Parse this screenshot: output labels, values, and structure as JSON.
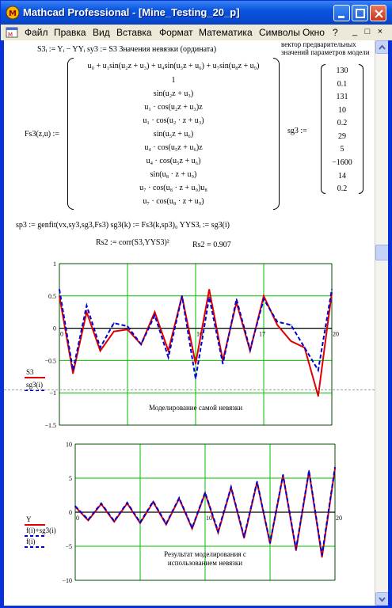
{
  "window": {
    "title": "Mathcad Professional - [Mine_Testing_20_p]",
    "colors": {
      "titlebar": "#0a55e0",
      "accent_red": "#e00000",
      "accent_blue": "#0000d0",
      "grid_green": "#00c000"
    }
  },
  "menu": [
    "Файл",
    "Правка",
    "Вид",
    "Вставка",
    "Формат",
    "Математика",
    "Символы",
    "Окно",
    "?"
  ],
  "mdi_buttons": [
    "_",
    "□",
    "×"
  ],
  "worksheet": {
    "line1": "S3ᵢ := Yᵢ − YYᵢ   sy3 := S3   Значения невязки (ордината)",
    "note_vector": [
      "вектор предварительных",
      "значений параметров модели"
    ],
    "fs3_lhs": "Fs3(z,u) :=",
    "fs3_rows": [
      "u₀ + u₁sin(u₂z + u₃) + u₄sin(u₅z + u₆) + u₇sin(u₈z + u₉)",
      "1",
      "sin(u₂z + u₃)",
      "u₁ · cos(u₂z + u₃)z",
      "u₁ · cos(u₂ · z + u₃)",
      "sin(u₅z + u₆)",
      "u₄ · cos(u₅z + u₆)z",
      "u₄ · cos(u₅z + u₆)",
      "sin(u₈ · z + u₉)",
      "u₇ · cos(u₈ · z + u₉)u₈",
      "u₇ · cos(u₈ · z + u₉)"
    ],
    "sg3_lhs": "sg3 :=",
    "sg3_values": [
      "130",
      "0.1",
      "131",
      "10",
      "0.2",
      "29",
      "5",
      "−1600",
      "14",
      "0.2"
    ],
    "line_genfit": "sp3 := genfit(vx,sy3,sg3,Fs3)      sg3(k) := Fs3(k,sp3)₀      YYS3ᵢ := sg3(i)",
    "line_corr": "Rs2 := corr(S3,YYS3)²",
    "line_corr_result": "Rs2 = 0.907"
  },
  "chart_data": [
    {
      "type": "line",
      "title": "Моделирование самой невязки",
      "legend": [
        "S3",
        "sg3(i)"
      ],
      "ylim": [
        -1.5,
        1
      ],
      "xlim": [
        0,
        20
      ],
      "yticks": [
        "1",
        "0.5",
        "0",
        "−0.5",
        "−1",
        "−1.5"
      ],
      "xticks": [
        "0",
        "10",
        "20"
      ],
      "x_extra_tick": "17",
      "grid": true,
      "series": [
        {
          "name": "S3",
          "color": "#e00000",
          "style": "solid",
          "x": [
            0,
            1,
            2,
            3,
            4,
            5,
            6,
            7,
            8,
            9,
            10,
            11,
            12,
            13,
            14,
            15,
            16,
            17,
            18,
            19,
            20
          ],
          "values": [
            0.5,
            -0.7,
            0.25,
            -0.35,
            -0.05,
            -0.02,
            -0.25,
            0.25,
            -0.35,
            0.5,
            -0.55,
            0.6,
            -0.5,
            0.4,
            -0.35,
            0.5,
            0.05,
            -0.2,
            -0.3,
            -1.05,
            0.55
          ]
        },
        {
          "name": "sg3(i)",
          "color": "#0000d0",
          "style": "dashed",
          "x": [
            0,
            1,
            2,
            3,
            4,
            5,
            6,
            7,
            8,
            9,
            10,
            11,
            12,
            13,
            14,
            15,
            16,
            17,
            18,
            19,
            20
          ],
          "values": [
            0.6,
            -0.65,
            0.35,
            -0.3,
            0.08,
            0.03,
            -0.25,
            0.2,
            -0.45,
            0.5,
            -0.78,
            0.48,
            -0.55,
            0.45,
            -0.33,
            0.45,
            0.1,
            0.05,
            -0.3,
            -0.65,
            0.6
          ]
        }
      ]
    },
    {
      "type": "line",
      "title": "Результат моделирования с использованием невязки",
      "legend": [
        "Y",
        "f(i)+sg3(i)",
        "f(i)"
      ],
      "ylim": [
        -10,
        10
      ],
      "xlim": [
        0,
        20
      ],
      "yticks": [
        "10",
        "5",
        "0",
        "−5",
        "−10"
      ],
      "xticks": [
        "0",
        "10",
        "20"
      ],
      "grid": true,
      "series": [
        {
          "name": "Y",
          "color": "#e00000",
          "style": "solid",
          "x": [
            0,
            1,
            2,
            3,
            4,
            5,
            6,
            7,
            8,
            9,
            10,
            11,
            12,
            13,
            14,
            15,
            16,
            17,
            18,
            19,
            20
          ],
          "values": [
            0.8,
            -1.2,
            1.2,
            -1.4,
            1.3,
            -1.6,
            1.5,
            -1.8,
            2.0,
            -2.4,
            2.8,
            -3.0,
            3.6,
            -3.8,
            4.4,
            -4.6,
            5.4,
            -5.6,
            6.0,
            -6.6,
            6.4
          ]
        },
        {
          "name": "f(i)+sg3(i)",
          "color": "#0000d0",
          "style": "dashed",
          "x": [
            0,
            1,
            2,
            3,
            4,
            5,
            6,
            7,
            8,
            9,
            10,
            11,
            12,
            13,
            14,
            15,
            16,
            17,
            18,
            19,
            20
          ],
          "values": [
            0.9,
            -1.1,
            1.3,
            -1.3,
            1.4,
            -1.5,
            1.6,
            -1.7,
            2.1,
            -2.3,
            2.9,
            -2.8,
            3.7,
            -3.6,
            4.5,
            -4.5,
            5.5,
            -5.4,
            6.1,
            -6.3,
            6.6
          ]
        }
      ]
    }
  ]
}
